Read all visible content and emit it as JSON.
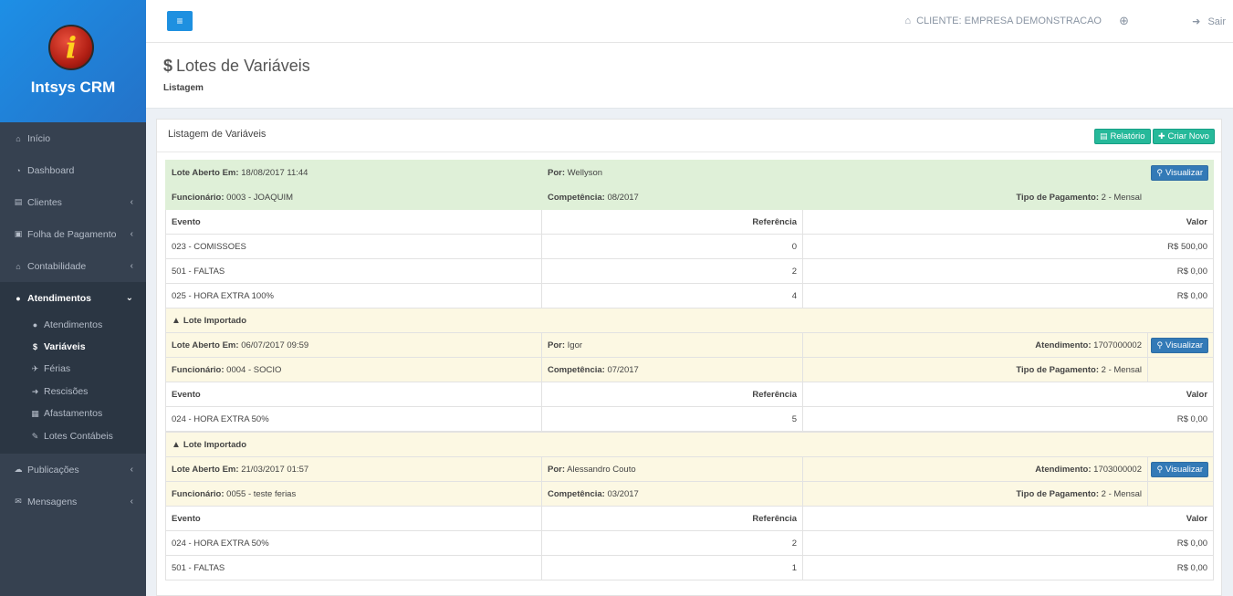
{
  "app": {
    "name": "Intsys CRM",
    "logo_letter": "i"
  },
  "sidebar": {
    "items": [
      {
        "label": "Início",
        "icon": "home-icon"
      },
      {
        "label": "Dashboard",
        "icon": "dashboard-icon"
      },
      {
        "label": "Clientes",
        "icon": "building-icon"
      },
      {
        "label": "Folha de Pagamento",
        "icon": "money-icon"
      },
      {
        "label": "Contabilidade",
        "icon": "bank-icon"
      },
      {
        "label": "Atendimentos",
        "icon": "comments-icon"
      },
      {
        "label": "Publicações",
        "icon": "cloud-icon"
      },
      {
        "label": "Mensagens",
        "icon": "envelope-icon"
      }
    ],
    "subitems": [
      {
        "label": "Atendimentos",
        "icon": "comments-icon"
      },
      {
        "label": "Variáveis",
        "icon": "dollar-icon"
      },
      {
        "label": "Férias",
        "icon": "plane-icon"
      },
      {
        "label": "Rescisões",
        "icon": "sign-out-icon"
      },
      {
        "label": "Afastamentos",
        "icon": "calendar-icon"
      },
      {
        "label": "Lotes Contábeis",
        "icon": "edit-icon"
      }
    ]
  },
  "topbar": {
    "client": "CLIENTE: EMPRESA DEMONSTRACAO",
    "logout": "Sair"
  },
  "page": {
    "title": "Lotes de Variáveis",
    "subtitle": "Listagem"
  },
  "panel": {
    "title": "Listagem de Variáveis",
    "report_btn": "Relatório",
    "create_btn": "Criar Novo",
    "view_btn": "Visualizar",
    "imported_label": "Lote Importado",
    "labels": {
      "opened": "Lote Aberto Em:",
      "by": "Por:",
      "employee": "Funcionário:",
      "competence": "Competência:",
      "payment": "Tipo de Pagamento:",
      "service": "Atendimento:"
    },
    "columns": {
      "event": "Evento",
      "ref": "Referência",
      "value": "Valor"
    }
  },
  "lots": [
    {
      "opened": "18/08/2017 11:44",
      "by": "Wellyson",
      "employee": "0003 - JOAQUIM",
      "competence": "08/2017",
      "payment": "2 - Mensal",
      "rows": [
        {
          "event": "023 - COMISSOES",
          "ref": "0",
          "value": "R$ 500,00"
        },
        {
          "event": "501 - FALTAS",
          "ref": "2",
          "value": "R$ 0,00"
        },
        {
          "event": "025 - HORA EXTRA 100%",
          "ref": "4",
          "value": "R$ 0,00"
        }
      ]
    },
    {
      "opened": "06/07/2017 09:59",
      "by": "Igor",
      "service": "1707000002",
      "employee": "0004 - SOCIO",
      "competence": "07/2017",
      "payment": "2 - Mensal",
      "rows": [
        {
          "event": "024 - HORA EXTRA 50%",
          "ref": "5",
          "value": "R$ 0,00"
        }
      ]
    },
    {
      "opened": "21/03/2017 01:57",
      "by": "Alessandro Couto",
      "service": "1703000002",
      "employee": "0055 - teste ferias",
      "competence": "03/2017",
      "payment": "2 - Mensal",
      "rows": [
        {
          "event": "024 - HORA EXTRA 50%",
          "ref": "2",
          "value": "R$ 0,00"
        },
        {
          "event": "501 - FALTAS",
          "ref": "1",
          "value": "R$ 0,00"
        }
      ]
    }
  ]
}
